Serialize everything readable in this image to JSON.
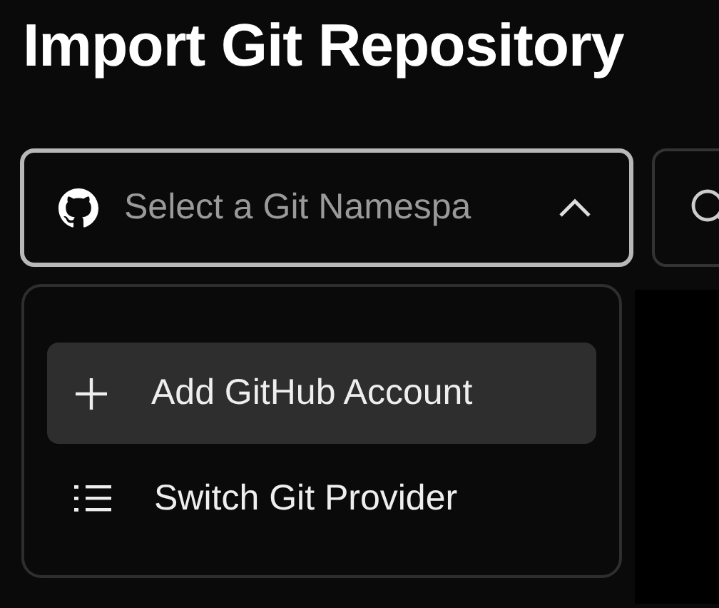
{
  "title": "Import Git Repository",
  "namespace_select": {
    "placeholder": "Select a Git Namespa",
    "expanded": true
  },
  "menu": [
    {
      "kind": "add",
      "label": "Add GitHub Account",
      "selected": true
    },
    {
      "kind": "list",
      "label": "Switch Git Provider",
      "selected": false
    }
  ]
}
